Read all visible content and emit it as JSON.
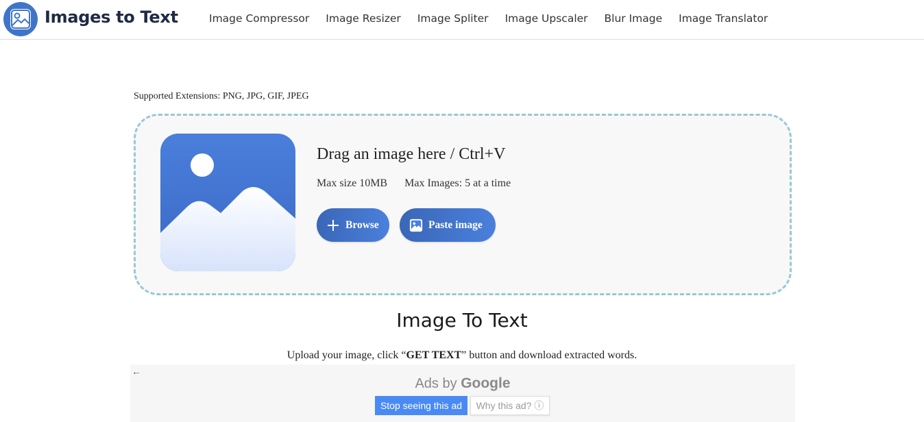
{
  "header": {
    "brand": "Images to Text",
    "nav": [
      "Image Compressor",
      "Image Resizer",
      "Image Spliter",
      "Image Upscaler",
      "Blur Image",
      "Image Translator"
    ]
  },
  "upload": {
    "supported": "Supported Extensions: PNG, JPG, GIF, JPEG",
    "title": "Drag an image here / Ctrl+V",
    "max_size": "Max size 10MB",
    "max_images": "Max Images: 5 at a time",
    "browse_label": "Browse",
    "paste_label": "Paste image"
  },
  "main": {
    "title": "Image To Text",
    "subtitle_pre": "Upload your image, click “",
    "subtitle_bold": "GET TEXT",
    "subtitle_post": "” button and download extracted words."
  },
  "ad": {
    "back_icon": "←",
    "ads_by": "Ads by",
    "google": "Google",
    "stop_label": "Stop seeing this ad",
    "why_label": "Why this ad? ⓘ"
  },
  "colors": {
    "accent": "#3f74c9",
    "dashed_border": "#98c8d4",
    "ad_button": "#4a8af4"
  }
}
